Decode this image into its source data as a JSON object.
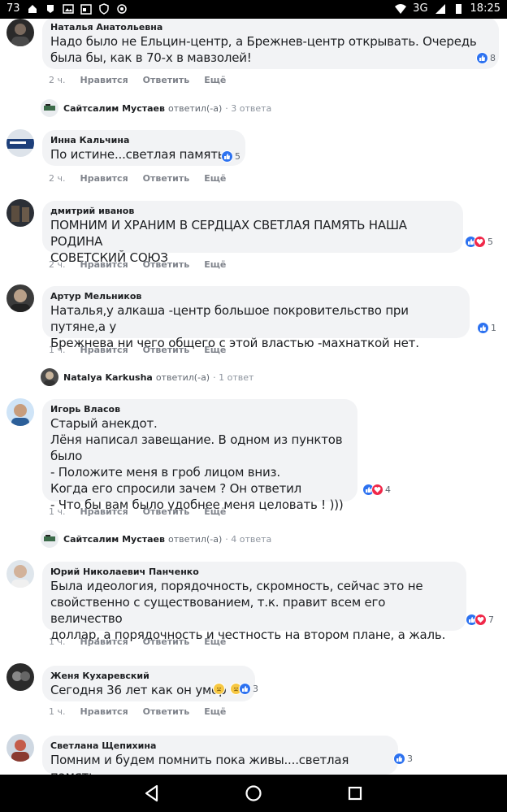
{
  "status": {
    "left_number": "73",
    "network": "3G",
    "time": "18:25",
    "icons_left": [
      "home-icon",
      "lock-icon",
      "image-icon",
      "calendar-icon",
      "shield-icon",
      "sync-icon"
    ],
    "icons_right": [
      "wifi-icon",
      "signal-icon",
      "battery-icon"
    ]
  },
  "actions": {
    "like": "Нравится",
    "reply": "Ответить",
    "more": "Ещё"
  },
  "comments": [
    {
      "author": "Наталья Анатольевна",
      "text": "Надо было не Ельцин-центр, а Брежнев-центр открывать. Очередь\nбыла бы, как в 70-х в мавзолей!",
      "reactions": "8",
      "time": "2 ч."
    },
    {
      "author": "Инна Кальчина",
      "text": "По истине...светлая память.",
      "reactions": "5",
      "time": "2 ч."
    },
    {
      "author": "дмитрий иванов",
      "text": "ПОМНИМ И ХРАНИМ В СЕРДЦАХ СВЕТЛАЯ ПАМЯТЬ НАША РОДИНА\nСОВЕТСКИЙ СОЮЗ",
      "reactions": "5",
      "time": "2 ч."
    },
    {
      "author": "Артур Мельников",
      "text": "Наталья,у алкаша -центр большое покровительство при путяне,а у\nБрежнева ни чего общего с этой властью -махнаткой нет.",
      "reactions": "1",
      "time": "1 ч."
    },
    {
      "author": "Игорь Власов",
      "text": "Старый анекдот.\nЛёня написал завещание. В одном из пунктов было\n- Положите меня в гроб лицом вниз.\nКогда его спросили зачем ? Он ответил\n- Что бы вам было удобнее меня целовать ! )))",
      "reactions": "4",
      "time": "1 ч."
    },
    {
      "author": "Юрий Николаевич Панченко",
      "text": "Была идеология, порядочность, скромность, сейчас это не\nсвойственно с существованием, т.к. правит всем его величество\nдоллар, а порядочность и честность на втором плане, а жаль.",
      "reactions": "7",
      "time": "1 ч."
    },
    {
      "author": "Женя Кухаревский",
      "text": "Сегодня 36 лет как он умер",
      "reactions": "3",
      "time": "1 ч."
    },
    {
      "author": "Светлана Щепихина",
      "text": "Помним и будем помнить пока живы....светлая память...",
      "reactions": "3",
      "time": ""
    }
  ],
  "replies": [
    {
      "name": "Сайтсалим Мустаев",
      "verb": "ответил(-а)",
      "count": "· 3 ответа"
    },
    {
      "name": "Natalya Karkusha",
      "verb": "ответил(-а)",
      "count": "· 1 ответ"
    },
    {
      "name": "Сайтсалим Мустаев",
      "verb": "ответил(-а)",
      "count": "· 4 ответа"
    }
  ],
  "colors": {
    "like": "#2d72f0",
    "love": "#f02849",
    "sad": "#f7c843",
    "bubble": "#f2f3f5"
  }
}
